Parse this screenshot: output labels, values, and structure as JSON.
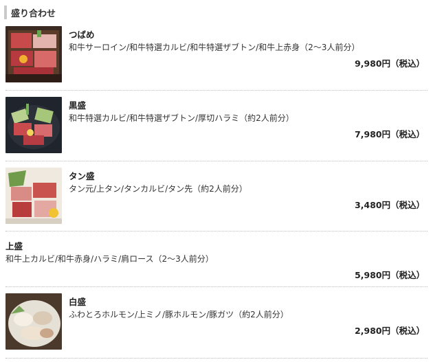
{
  "section": {
    "title": "盛り合わせ"
  },
  "items": [
    {
      "name": "つばめ",
      "description": "和牛サーロイン/和牛特選カルビ/和牛特選ザブトン/和牛上赤身（2〜3人前分）",
      "price": "9,980円（税込）"
    },
    {
      "name": "黒盛",
      "description": "和牛特選カルビ/和牛特選ザブトン/厚切ハラミ（約2人前分）",
      "price": "7,980円（税込）"
    },
    {
      "name": "タン盛",
      "description": "タン元/上タン/タンカルビ/タン先（約2人前分）",
      "price": "3,480円（税込）"
    },
    {
      "name": "上盛",
      "description": "和牛上カルビ/和牛赤身/ハラミ/肩ロース（2〜3人前分）",
      "price": "5,980円（税込）"
    },
    {
      "name": "白盛",
      "description": "ふわとろホルモン/上ミノ/豚ホルモン/豚ガツ（約2人前分）",
      "price": "2,980円（税込）"
    }
  ]
}
